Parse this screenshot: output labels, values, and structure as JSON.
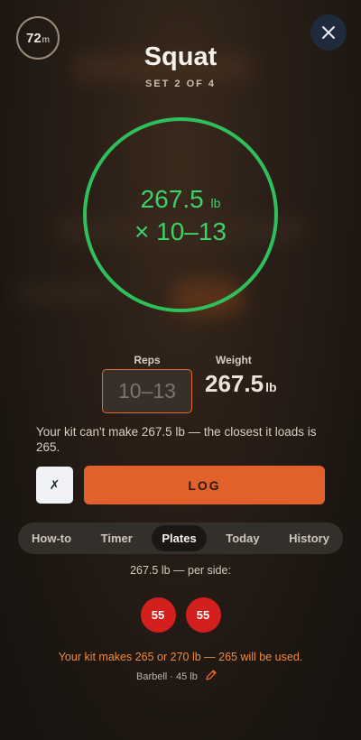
{
  "session": {
    "time_value": "72",
    "time_unit": "m"
  },
  "exercise": {
    "name": "Squat",
    "set_label": "SET 2 OF 4"
  },
  "target": {
    "weight": "267.5",
    "unit": "lb",
    "reps_line": "× 10–13"
  },
  "inputs": {
    "reps_label": "Reps",
    "reps_placeholder": "10–13",
    "weight_label": "Weight",
    "weight_value": "267.5",
    "weight_unit": "lb"
  },
  "warning": "Your kit can't make 267.5 lb — the closest it loads is 265.",
  "actions": {
    "cancel_label": "✗",
    "log_label": "LOG"
  },
  "tabs": [
    {
      "label": "How-to",
      "active": false
    },
    {
      "label": "Timer",
      "active": false
    },
    {
      "label": "Plates",
      "active": true
    },
    {
      "label": "Today",
      "active": false
    },
    {
      "label": "History",
      "active": false
    }
  ],
  "plates_panel": {
    "per_side_text": "267.5 lb — per side:",
    "plates": [
      "55",
      "55"
    ],
    "kit_note": "Your kit makes 265 or 270 lb — 265 will be used.",
    "barbell_text": "Barbell · 45 lb"
  },
  "colors": {
    "accent": "#e2612b",
    "ring": "#2fbf5b",
    "plate": "#d41f1f",
    "note": "#f28a3c"
  },
  "icons": {
    "close": "close-icon",
    "edit": "pencil-icon"
  }
}
